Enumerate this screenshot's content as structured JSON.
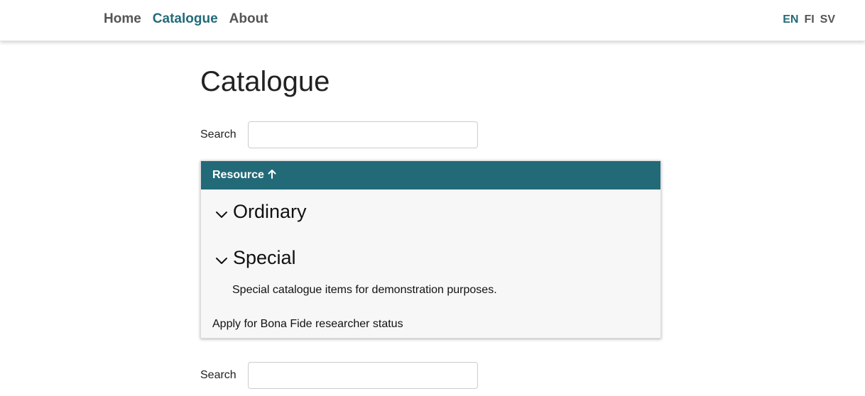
{
  "nav": {
    "links": [
      "Home",
      "Catalogue",
      "About"
    ],
    "active": "Catalogue",
    "languages": [
      "EN",
      "FI",
      "SV"
    ],
    "active_language": "EN"
  },
  "page": {
    "title": "Catalogue"
  },
  "search": {
    "label": "Search",
    "value": "",
    "placeholder": ""
  },
  "table": {
    "header": "Resource",
    "sort_indicator": "ascending",
    "categories": [
      {
        "title": "Ordinary",
        "description": ""
      },
      {
        "title": "Special",
        "description": "Special catalogue items for demonstration purposes."
      }
    ],
    "apply_link": "Apply for Bona Fide researcher status"
  },
  "search_bottom": {
    "label": "Search",
    "value": ""
  },
  "colors": {
    "accent": "#236a78",
    "nav_text": "#555555",
    "panel_bg": "#f7f7f7"
  },
  "icons": [
    "arrow-up-icon",
    "chevron-down-icon"
  ]
}
